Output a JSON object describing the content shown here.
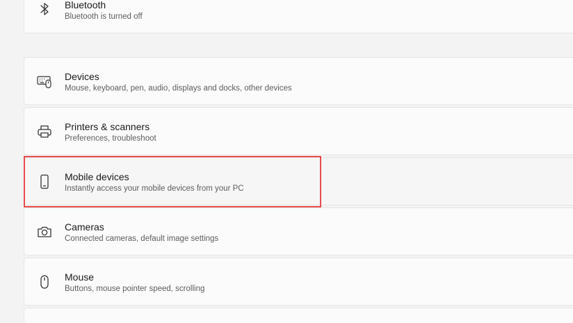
{
  "items": [
    {
      "title": "Bluetooth",
      "subtitle": "Bluetooth is turned off",
      "icon": "bluetooth-icon"
    },
    {
      "title": "Devices",
      "subtitle": "Mouse, keyboard, pen, audio, displays and docks, other devices",
      "icon": "devices-icon"
    },
    {
      "title": "Printers & scanners",
      "subtitle": "Preferences, troubleshoot",
      "icon": "printer-icon"
    },
    {
      "title": "Mobile devices",
      "subtitle": "Instantly access your mobile devices from your PC",
      "icon": "mobile-phone-icon"
    },
    {
      "title": "Cameras",
      "subtitle": "Connected cameras, default image settings",
      "icon": "camera-icon"
    },
    {
      "title": "Mouse",
      "subtitle": "Buttons, mouse pointer speed, scrolling",
      "icon": "mouse-icon"
    }
  ],
  "colors": {
    "background": "#f3f3f3",
    "card": "#fbfbfb",
    "highlight_border": "#e84c4c"
  }
}
